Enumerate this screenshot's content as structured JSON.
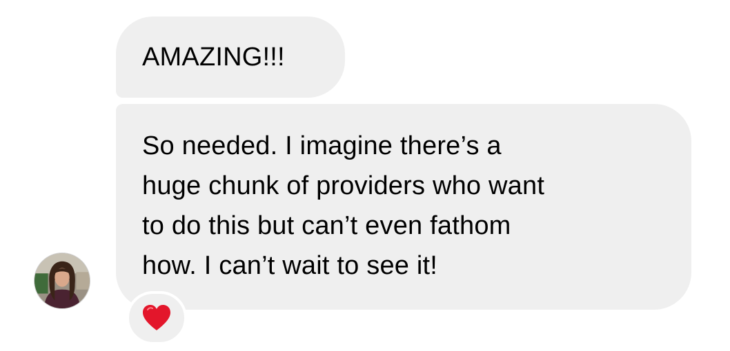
{
  "messages": [
    {
      "lines": [
        "AMAZING!!!"
      ]
    },
    {
      "lines": [
        "So needed. I imagine there’s a",
        "huge chunk of providers who want",
        "to do this but can’t even fathom",
        "how. I can’t wait to see it!"
      ]
    }
  ],
  "reaction": {
    "icon": "red-heart-icon",
    "color": "#e3162b"
  },
  "avatar": {
    "icon": "sender-avatar"
  },
  "colors": {
    "bubble_background": "#efefef",
    "text": "#000000"
  }
}
